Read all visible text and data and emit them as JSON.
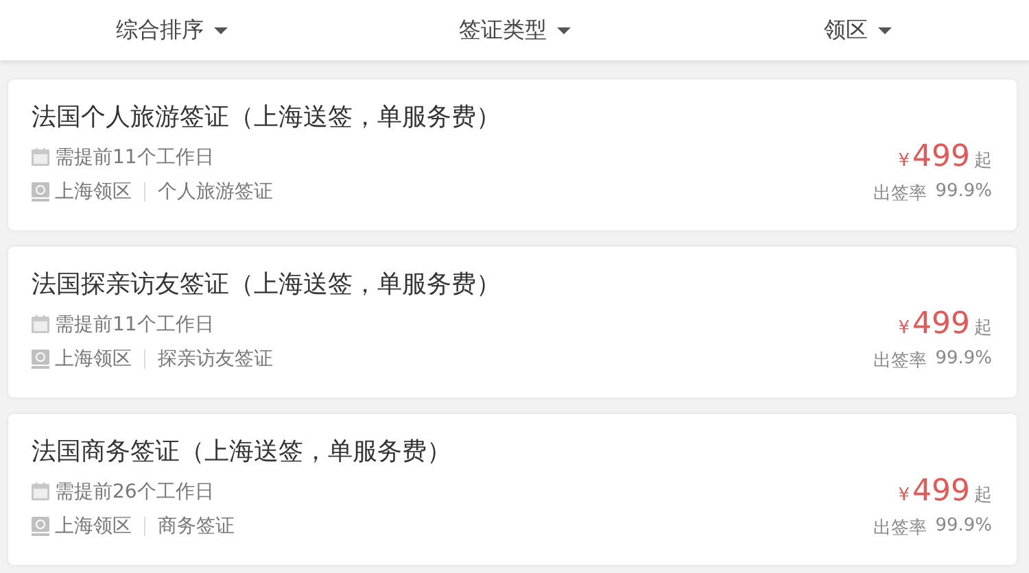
{
  "filters": [
    {
      "label": "综合排序"
    },
    {
      "label": "签证类型"
    },
    {
      "label": "领区"
    }
  ],
  "products": [
    {
      "title": "法国个人旅游签证（上海送签，单服务费）",
      "lead_time": "需提前11个工作日",
      "consulate": "上海领区",
      "visa_type": "个人旅游签证",
      "currency": "¥",
      "price": "499",
      "price_suffix": "起",
      "rate_label": "出签率",
      "rate": "99.9%"
    },
    {
      "title": "法国探亲访友签证（上海送签，单服务费）",
      "lead_time": "需提前11个工作日",
      "consulate": "上海领区",
      "visa_type": "探亲访友签证",
      "currency": "¥",
      "price": "499",
      "price_suffix": "起",
      "rate_label": "出签率",
      "rate": "99.9%"
    },
    {
      "title": "法国商务签证（上海送签，单服务费）",
      "lead_time": "需提前26个工作日",
      "consulate": "上海领区",
      "visa_type": "商务签证",
      "currency": "¥",
      "price": "499",
      "price_suffix": "起",
      "rate_label": "出签率",
      "rate": "99.9%"
    }
  ]
}
